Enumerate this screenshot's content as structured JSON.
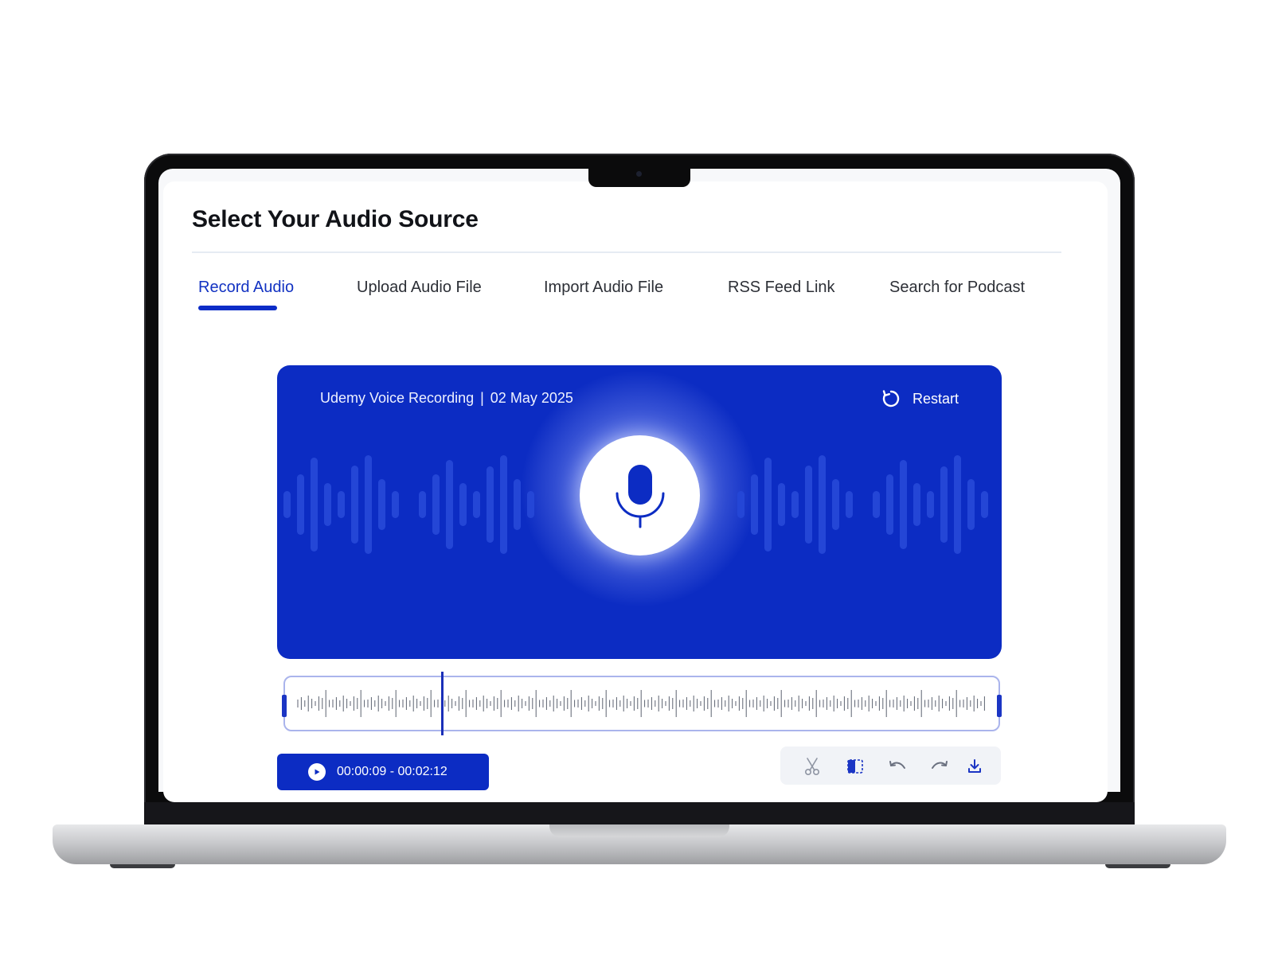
{
  "page": {
    "title": "Select Your Audio Source"
  },
  "tabs": [
    {
      "label": "Record Audio",
      "active": true
    },
    {
      "label": "Upload Audio File",
      "active": false
    },
    {
      "label": "Import Audio File",
      "active": false
    },
    {
      "label": "RSS Feed Link",
      "active": false
    },
    {
      "label": "Search for Podcast",
      "active": false
    }
  ],
  "recorder": {
    "name": "Udemy Voice Recording",
    "separator": "|",
    "date": "02 May 2025",
    "restart_label": "Restart",
    "mic_icon": "microphone-icon",
    "restart_icon": "refresh-icon"
  },
  "playback": {
    "time_range": "00:00:09 - 00:02:12",
    "play_icon": "play-icon"
  },
  "tools": [
    {
      "name": "cut",
      "icon": "scissors-icon",
      "active": false
    },
    {
      "name": "split",
      "icon": "split-icon",
      "active": true
    },
    {
      "name": "undo",
      "icon": "undo-icon",
      "active": false
    },
    {
      "name": "redo",
      "icon": "redo-icon",
      "active": false
    },
    {
      "name": "download",
      "icon": "download-icon",
      "active": false
    }
  ],
  "colors": {
    "accent": "#0C2CC3",
    "active_tab": "#1232C2",
    "text": "#2C2F36"
  }
}
